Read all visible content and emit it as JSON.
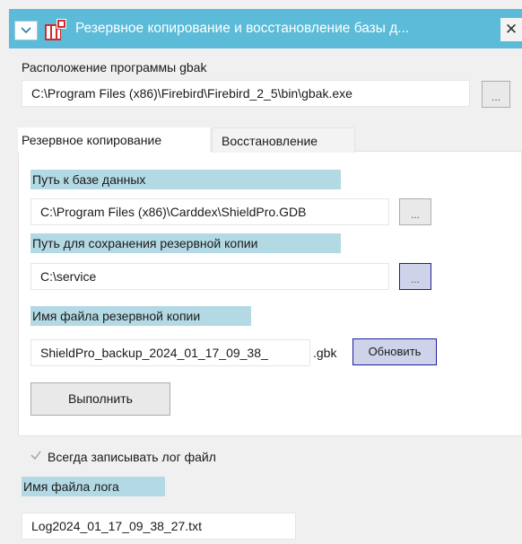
{
  "window": {
    "title": "Резервное копирование и восстановление базы д...",
    "close_glyph": "✕",
    "accent_color": "#5bbbd8",
    "icons": [
      "chevron-down-icon",
      "database-app-icon",
      "close-icon"
    ]
  },
  "gbak": {
    "label": "Расположение программы gbak",
    "path": "C:\\Program Files (x86)\\Firebird\\Firebird_2_5\\bin\\gbak.exe",
    "browse_label": "..."
  },
  "tabs": [
    {
      "label": "Резервное копирование",
      "active": true
    },
    {
      "label": "Восстановление",
      "active": false
    }
  ],
  "backup": {
    "db_path_label": "Путь к базе данных",
    "db_path_value": "C:\\Program Files (x86)\\Carddex\\ShieldPro.GDB",
    "db_browse_label": "...",
    "save_path_label": "Путь для сохранения резервной копии",
    "save_path_value": "C:\\service",
    "save_browse_label": "...",
    "file_name_label": "Имя файла резервной копии",
    "file_name_value": "ShieldPro_backup_2024_01_17_09_38_",
    "file_ext": ".gbk",
    "refresh_label": "Обновить",
    "run_label": "Выполнить"
  },
  "log": {
    "always_write_label": "Всегда записывать лог файл",
    "always_write_checked": true,
    "file_name_label": "Имя файла лога",
    "file_name_value": "Log2024_01_17_09_38_27.txt"
  }
}
